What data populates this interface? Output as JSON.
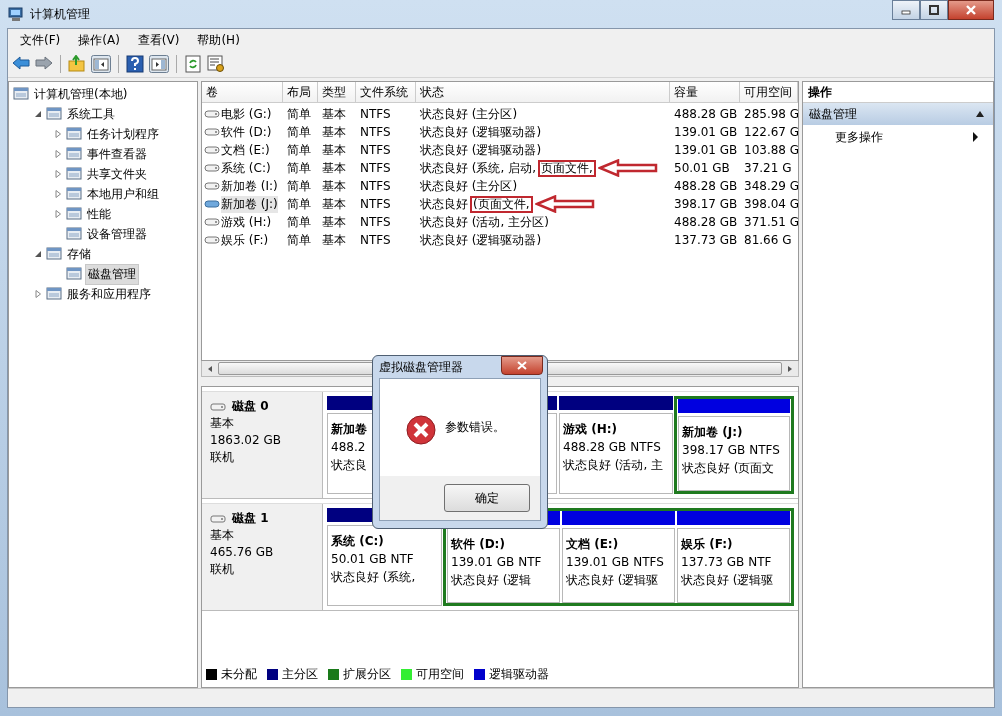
{
  "window": {
    "title": "计算机管理"
  },
  "menu": [
    "文件(F)",
    "操作(A)",
    "查看(V)",
    "帮助(H)"
  ],
  "tree": [
    {
      "label": "计算机管理(本地)",
      "expandable": false,
      "selected": false,
      "children": [
        {
          "label": "系统工具",
          "expandable": true,
          "expanded": true,
          "selected": false,
          "children": [
            {
              "label": "任务计划程序",
              "expandable": true,
              "expanded": false,
              "selected": false
            },
            {
              "label": "事件查看器",
              "expandable": true,
              "expanded": false,
              "selected": false
            },
            {
              "label": "共享文件夹",
              "expandable": true,
              "expanded": false,
              "selected": false
            },
            {
              "label": "本地用户和组",
              "expandable": true,
              "expanded": false,
              "selected": false
            },
            {
              "label": "性能",
              "expandable": true,
              "expanded": false,
              "selected": false
            },
            {
              "label": "设备管理器",
              "expandable": false,
              "selected": false
            }
          ]
        },
        {
          "label": "存储",
          "expandable": true,
          "expanded": true,
          "selected": false,
          "children": [
            {
              "label": "磁盘管理",
              "expandable": false,
              "selected": true
            }
          ]
        },
        {
          "label": "服务和应用程序",
          "expandable": true,
          "expanded": false,
          "selected": false
        }
      ]
    }
  ],
  "table": {
    "columns": [
      "卷",
      "布局",
      "类型",
      "文件系统",
      "状态",
      "容量",
      "可用空间"
    ],
    "rows": [
      {
        "selected": false,
        "cells": [
          "电影 (G:)",
          "简单",
          "基本",
          "NTFS",
          "状态良好 (主分区)",
          "488.28 GB",
          "285.98 G"
        ]
      },
      {
        "selected": false,
        "cells": [
          "软件 (D:)",
          "简单",
          "基本",
          "NTFS",
          "状态良好 (逻辑驱动器)",
          "139.01 GB",
          "122.67 G"
        ]
      },
      {
        "selected": false,
        "cells": [
          "文档 (E:)",
          "简单",
          "基本",
          "NTFS",
          "状态良好 (逻辑驱动器)",
          "139.01 GB",
          "103.88 G"
        ]
      },
      {
        "selected": false,
        "cells": [
          "系统 (C:)",
          "简单",
          "基本",
          "NTFS",
          "状态良好 (系统, 启动,",
          "50.01 GB",
          "37.21 G"
        ],
        "highlight": "页面文件,"
      },
      {
        "selected": false,
        "cells": [
          "新加卷 (I:)",
          "简单",
          "基本",
          "NTFS",
          "状态良好 (主分区)",
          "488.28 GB",
          "348.29 G"
        ]
      },
      {
        "selected": true,
        "cells": [
          "新加卷 (J:)",
          "简单",
          "基本",
          "NTFS",
          "状态良好",
          "398.17 GB",
          "398.04 G"
        ],
        "highlight": "(页面文件,"
      },
      {
        "selected": false,
        "cells": [
          "游戏 (H:)",
          "简单",
          "基本",
          "NTFS",
          "状态良好 (活动, 主分区)",
          "488.28 GB",
          "371.51 G"
        ]
      },
      {
        "selected": false,
        "cells": [
          "娱乐 (F:)",
          "简单",
          "基本",
          "NTFS",
          "状态良好 (逻辑驱动器)",
          "137.73 GB",
          "81.66 G"
        ]
      }
    ]
  },
  "disks": [
    {
      "name": "磁盘 0",
      "type": "基本",
      "size": "1863.02 GB",
      "state": "联机",
      "partitions": [
        {
          "kind": "primary",
          "name": "新加卷",
          "size": "488.2",
          "status": "状态良"
        },
        {
          "kind": "primary"
        },
        {
          "kind": "primary",
          "name": "游戏 (H:)",
          "size": "488.28 GB NTFS",
          "status": "状态良好 (活动, 主"
        },
        {
          "kind": "logical",
          "name": "新加卷 (J:)",
          "size": "398.17 GB NTFS",
          "status": "状态良好 (页面文"
        }
      ]
    },
    {
      "name": "磁盘 1",
      "type": "基本",
      "size": "465.76 GB",
      "state": "联机",
      "partitions": [
        {
          "kind": "primary",
          "name": "系统 (C:)",
          "size": "50.01 GB NTF",
          "status": "状态良好 (系统,"
        },
        {
          "kind": "logical",
          "name": "软件 (D:)",
          "size": "139.01 GB NTF",
          "status": "状态良好 (逻辑"
        },
        {
          "kind": "logical",
          "name": "文档 (E:)",
          "size": "139.01 GB NTFS",
          "status": "状态良好 (逻辑驱"
        },
        {
          "kind": "logical",
          "name": "娱乐 (F:)",
          "size": "137.73 GB NTF",
          "status": "状态良好 (逻辑驱"
        }
      ]
    }
  ],
  "legend": [
    {
      "label": "未分配",
      "color": "#000000"
    },
    {
      "label": "主分区",
      "color": "#000080"
    },
    {
      "label": "扩展分区",
      "color": "#1a7a1a"
    },
    {
      "label": "可用空间",
      "color": "#33ee33"
    },
    {
      "label": "逻辑驱动器",
      "color": "#0000cc"
    }
  ],
  "actions": {
    "header": "操作",
    "section": {
      "label": "磁盘管理",
      "expanded": true
    },
    "items": [
      "更多操作"
    ]
  },
  "dialog": {
    "title": "虚拟磁盘管理器",
    "message": "参数错误。",
    "button": "确定"
  }
}
